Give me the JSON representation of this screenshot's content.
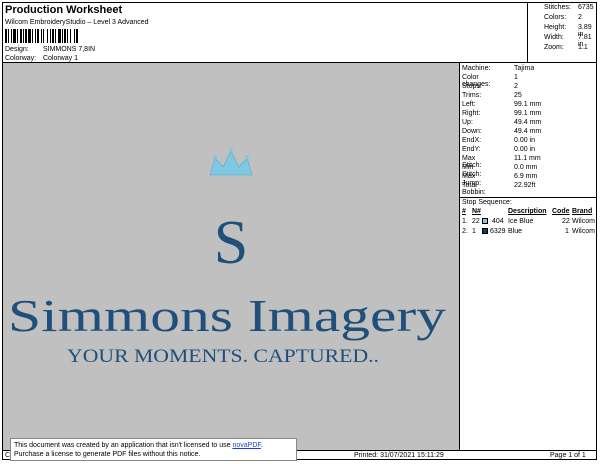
{
  "header": {
    "title": "Production Worksheet",
    "subtitle": "Wilcom EmbroideryStudio – Level 3 Advanced",
    "design_label": "Design:",
    "design_value": "SIMMONS 7,8IN",
    "colorway_label": "Colorway:",
    "colorway_value": "Colorway 1"
  },
  "stats": [
    {
      "label": "Stitches:",
      "value": "6735"
    },
    {
      "label": "Colors:",
      "value": "2"
    },
    {
      "label": "Height:",
      "value": "3.89 in"
    },
    {
      "label": "Width:",
      "value": "7.81 in"
    },
    {
      "label": "Zoom:",
      "value": "1:1"
    }
  ],
  "machine": [
    {
      "label": "Machine:",
      "value": "Tajima"
    },
    {
      "label": "Color changes:",
      "value": "1"
    },
    {
      "label": "Stops:",
      "value": "2"
    },
    {
      "label": "Trims:",
      "value": "25"
    },
    {
      "label": "Left:",
      "value": "99.1 mm"
    },
    {
      "label": "Right:",
      "value": "99.1 mm"
    },
    {
      "label": "Up:",
      "value": "49.4 mm"
    },
    {
      "label": "Down:",
      "value": "49.4 mm"
    },
    {
      "label": "EndX:",
      "value": "0.00 in"
    },
    {
      "label": "EndY:",
      "value": "0.00 in"
    },
    {
      "label": "Max Stitch:",
      "value": "11.1 mm"
    },
    {
      "label": "Min Stitch:",
      "value": "0.0 mm"
    },
    {
      "label": "Max Jump:",
      "value": "6.9 mm"
    },
    {
      "label": "Total Bobbin:",
      "value": "22.92ft"
    }
  ],
  "stop_sequence": {
    "title": "Stop Sequence:",
    "headers": {
      "num": "#",
      "n": "N#",
      "code_sw": "",
      "color": "",
      "description": "Description",
      "code": "Code",
      "brand": "Brand"
    },
    "rows": [
      {
        "num": "1.",
        "n": "22",
        "color": "#7ec8e3",
        "code1": "404",
        "description": "Ice Blue",
        "code": "22",
        "brand": "Wilcom"
      },
      {
        "num": "2.",
        "n": "1",
        "color": "#123a66",
        "code1": "6329",
        "description": "Blue",
        "code": "1",
        "brand": "Wilcom"
      }
    ]
  },
  "design": {
    "monogram": "S",
    "name": "Simmons Imagery",
    "tagline": "YOUR MOMENTS. CAPTURED..",
    "crown_color": "#7ec8e3",
    "text_color": "#1f4f7a"
  },
  "footer": {
    "left": "Cr",
    "printed": "Printed: 31/07/2021 15:11:29",
    "page": "Page 1 of 1"
  },
  "notice": {
    "line1": "This document was created by an application that isn't licensed to use",
    "link": "novaPDF",
    "line1_end": ".",
    "line2": "Purchase a license to generate PDF files without this notice."
  }
}
